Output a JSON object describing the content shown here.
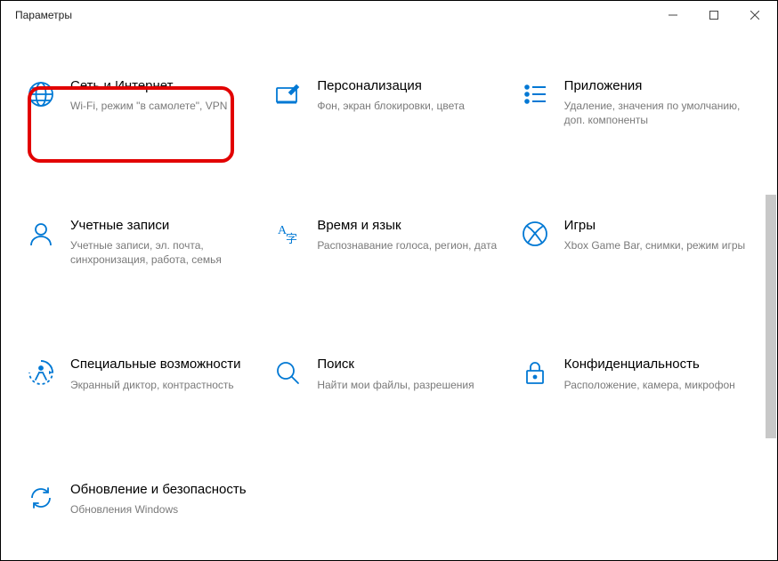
{
  "window": {
    "title": "Параметры"
  },
  "categories": [
    {
      "title": "Сеть и Интернет",
      "desc": "Wi-Fi, режим \"в самолете\", VPN"
    },
    {
      "title": "Персонализация",
      "desc": "Фон, экран блокировки, цвета"
    },
    {
      "title": "Приложения",
      "desc": "Удаление, значения по умолчанию, доп. компоненты"
    },
    {
      "title": "Учетные записи",
      "desc": "Учетные записи, эл. почта, синхронизация, работа, семья"
    },
    {
      "title": "Время и язык",
      "desc": "Распознавание голоса, регион, дата"
    },
    {
      "title": "Игры",
      "desc": "Xbox Game Bar, снимки, режим игры"
    },
    {
      "title": "Специальные возможности",
      "desc": "Экранный диктор, контрастность"
    },
    {
      "title": "Поиск",
      "desc": "Найти мои файлы, разрешения"
    },
    {
      "title": "Конфиденциальность",
      "desc": "Расположение, камера, микрофон"
    },
    {
      "title": "Обновление и безопасность",
      "desc": "Обновления Windows"
    }
  ]
}
